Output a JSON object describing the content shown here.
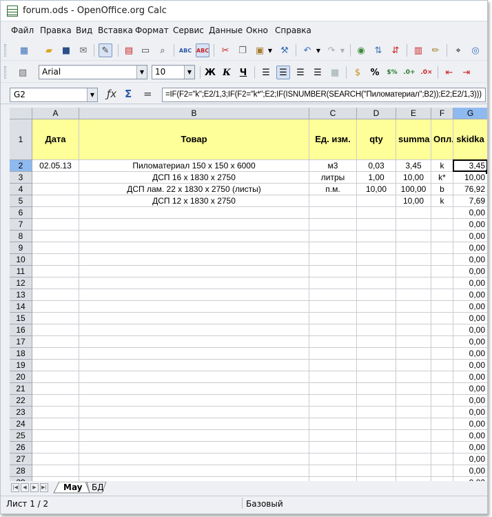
{
  "window": {
    "title": "forum.ods - OpenOffice.org Calc"
  },
  "menu": [
    {
      "label": "Файл"
    },
    {
      "label": "Правка"
    },
    {
      "label": "Вид"
    },
    {
      "label": "Вставка"
    },
    {
      "label": "Формат"
    },
    {
      "label": "Сервис"
    },
    {
      "label": "Данные"
    },
    {
      "label": "Окно"
    },
    {
      "label": "Справка"
    }
  ],
  "format_toolbar": {
    "font_name": "Arial",
    "font_size": "10",
    "bold": "Ж",
    "italic": "К",
    "underline": "Ч"
  },
  "formula_bar": {
    "cell_ref": "G2",
    "formula": "=IF(F2=\"k\";E2/1,3;IF(F2=\"k*\";E2;IF(ISNUMBER(SEARCH(\"Пиломатериал\";B2));E2;E2/1,3)))"
  },
  "columns": [
    "A",
    "B",
    "C",
    "D",
    "E",
    "F",
    "G"
  ],
  "header_row": [
    "Дата",
    "Товар",
    "Ед. изм.",
    "qty",
    "summa",
    "Опл.",
    "skidka"
  ],
  "rows": [
    [
      "02.05.13",
      "Пиломатериал 150 х 150 х 6000",
      "м3",
      "0,03",
      "3,45",
      "k",
      "3,45"
    ],
    [
      "",
      "ДСП 16 х 1830 х 2750",
      "литры",
      "1,00",
      "10,00",
      "k*",
      "10,00"
    ],
    [
      "",
      "ДСП лам. 22 х 1830 х 2750 (листы)",
      "п.м.",
      "10,00",
      "100,00",
      "b",
      "76,92"
    ],
    [
      "",
      "ДСП 12 х 1830 х 2750",
      "",
      "",
      "10,00",
      "k",
      "7,69"
    ]
  ],
  "empty_row_value": "0,00",
  "row_numbers": [
    "1",
    "2",
    "3",
    "4",
    "5",
    "6",
    "7",
    "8",
    "9",
    "10",
    "11",
    "12",
    "13",
    "14",
    "15",
    "16",
    "17",
    "18",
    "19",
    "20",
    "21",
    "22",
    "23",
    "24",
    "25",
    "26",
    "27",
    "28",
    "29"
  ],
  "sheet_tabs": [
    {
      "label": "May",
      "active": true
    },
    {
      "label": "БД",
      "active": false
    }
  ],
  "status": {
    "sheet": "Лист 1 / 2",
    "style": "Базовый"
  }
}
